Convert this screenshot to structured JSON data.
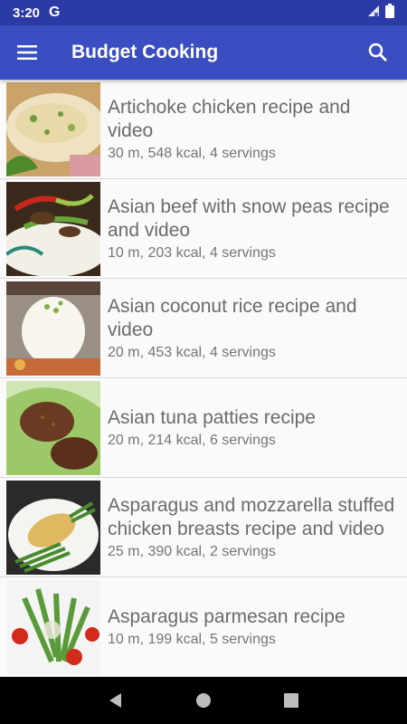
{
  "status": {
    "time": "3:20",
    "app_glyph": "G"
  },
  "app_bar": {
    "title": "Budget Cooking",
    "menu_icon": "menu-icon",
    "search_icon": "search-icon"
  },
  "recipes": [
    {
      "title": "Artichoke chicken recipe and video",
      "meta": "30 m, 548 kcal, 4 servings"
    },
    {
      "title": "Asian beef with snow peas recipe and video",
      "meta": "10 m, 203 kcal, 4 servings"
    },
    {
      "title": "Asian coconut rice recipe and video",
      "meta": "20 m, 453 kcal, 4 servings"
    },
    {
      "title": "Asian tuna patties recipe",
      "meta": "20 m, 214 kcal, 6 servings"
    },
    {
      "title": "Asparagus and mozzarella stuffed chicken breasts recipe and video",
      "meta": "25 m, 390 kcal, 2 servings"
    },
    {
      "title": "Asparagus parmesan recipe",
      "meta": "10 m, 199 kcal, 5 servings"
    }
  ],
  "nav": {
    "back": "back-icon",
    "home": "home-icon",
    "recents": "recents-icon"
  },
  "colors": {
    "status_bar": "#2c3aa6",
    "app_bar": "#3a4ec2"
  }
}
